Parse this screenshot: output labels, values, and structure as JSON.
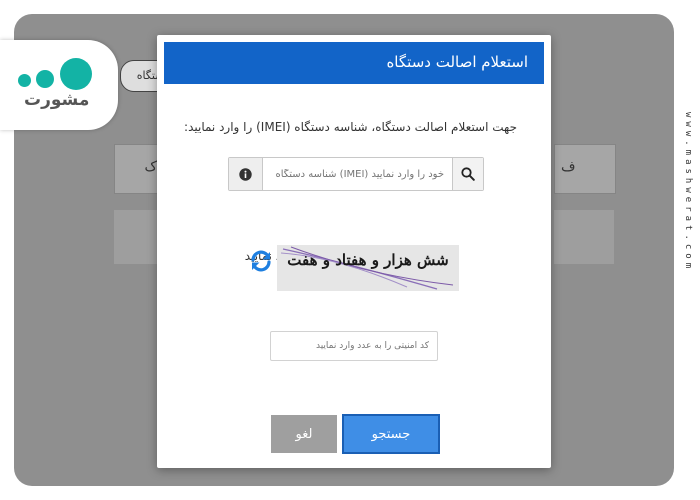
{
  "background": {
    "chip_label": "دستگاه",
    "row_glyph_left": "ک",
    "row_glyph_right": "ف"
  },
  "logo": {
    "text": "مشورت"
  },
  "watermark": "www.mashwerat.com",
  "modal": {
    "title": "استعلام اصالت دستگاه",
    "instruction": "جهت استعلام اصالت دستگاه، شناسه دستگاه (IMEI) را وارد نمایید:",
    "imei_placeholder": "خود را وارد نمایید (IMEI) شناسه دستگاه",
    "captcha_label": "عبارت امنیتی را به عدد وارد نمایید",
    "captcha_text": "شش هزار و هفتاد و هفت",
    "captcha_placeholder": "کد امنیتی را به عدد وارد نمایید",
    "cancel_label": "لغو",
    "search_label": "جستجو"
  },
  "colors": {
    "header": "#1264c8",
    "search_button": "#3f8ee6",
    "cancel_button": "#9f9f9f",
    "refresh_icon": "#1e7fe0",
    "logo_accent": "#13b3a5"
  },
  "icons": {
    "search": "search-icon",
    "info": "info-icon",
    "refresh": "refresh-icon"
  }
}
